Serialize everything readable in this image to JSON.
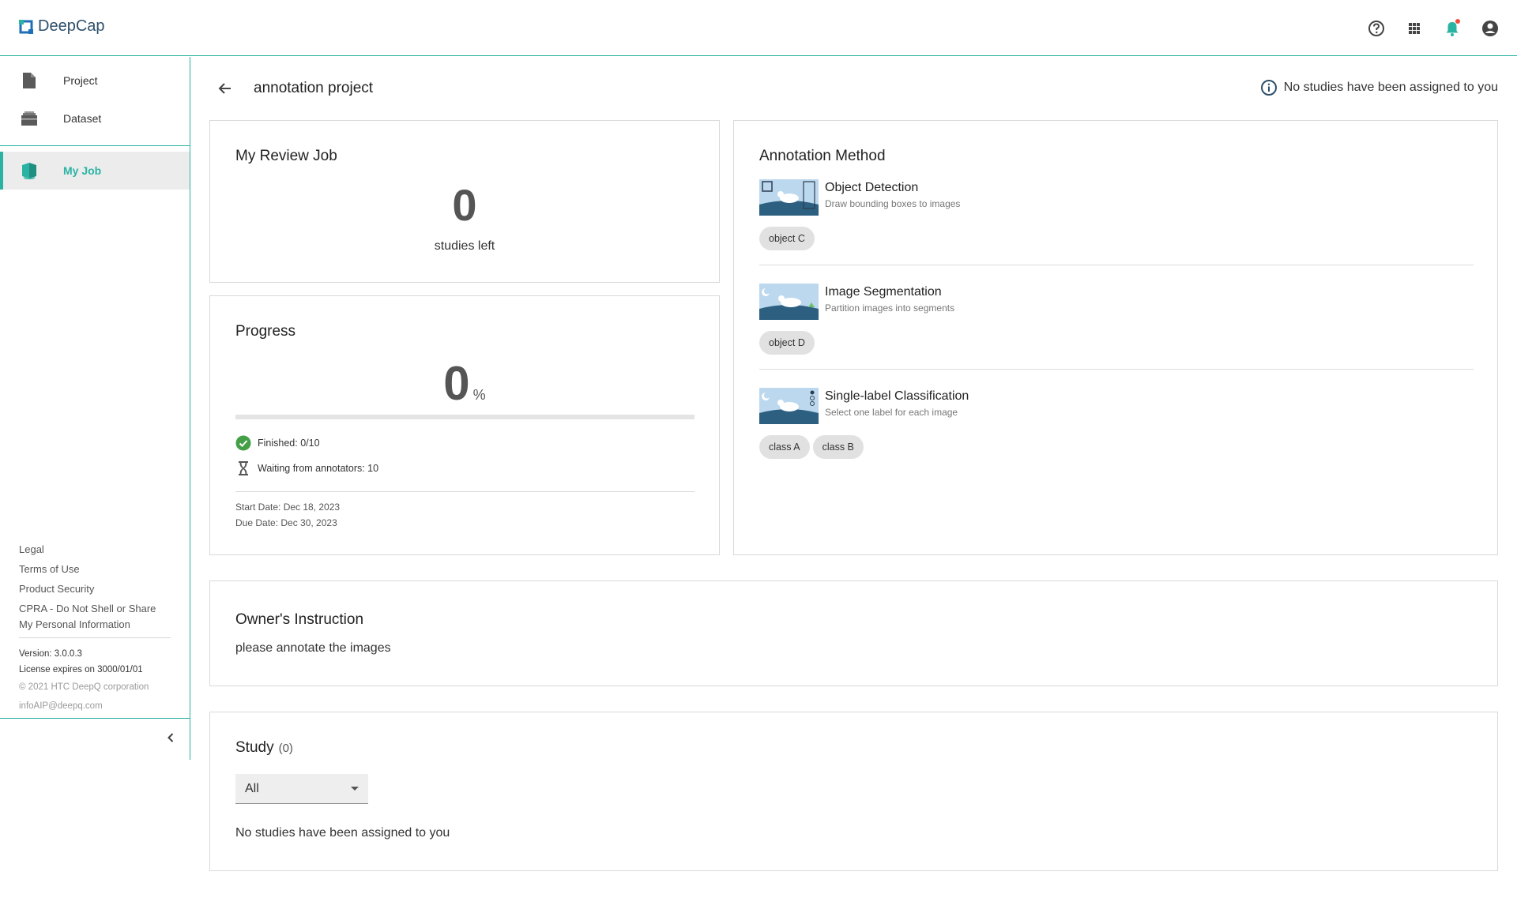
{
  "app": {
    "name": "DeepCap",
    "brand_color": "#2ab3a3"
  },
  "topbar": {
    "icons": [
      "help-circle-icon",
      "apps-grid-icon",
      "bell-icon",
      "account-circle-icon"
    ],
    "notification_dot_color": "#f04e3e"
  },
  "sidebar": {
    "items": [
      {
        "label": "Project",
        "icon": "file-icon"
      },
      {
        "label": "Dataset",
        "icon": "briefcase-icon"
      },
      {
        "label": "My Job",
        "icon": "book-icon",
        "active": true
      }
    ],
    "footer": {
      "legal": "Legal",
      "terms": "Terms of Use",
      "security": "Product Security",
      "cpra": "CPRA - Do Not Shell or Share My Personal Information",
      "version": "Version: 3.0.0.3",
      "license": "License expires on 3000/01/01",
      "copyright": "© 2021 HTC DeepQ corporation",
      "email": "infoAIP@deepq.com"
    }
  },
  "main": {
    "title": "annotation project",
    "assign_note": "No studies have been assigned to you",
    "review_job": {
      "title": "My Review Job",
      "count": "0",
      "subtitle": "studies left"
    },
    "progress": {
      "title": "Progress",
      "value": "0",
      "unit": "%",
      "fraction": 0,
      "finished": "Finished: 0/10",
      "waiting": "Waiting from annotators: 10",
      "start_date": "Start Date: Dec 18, 2023",
      "due_date": "Due Date: Dec 30, 2023"
    },
    "annotation_method": {
      "title": "Annotation Method",
      "methods": [
        {
          "name": "Object Detection",
          "desc": "Draw bounding boxes to images",
          "chips": [
            "object C"
          ]
        },
        {
          "name": "Image Segmentation",
          "desc": "Partition images into segments",
          "chips": [
            "object D"
          ]
        },
        {
          "name": "Single-label Classification",
          "desc": "Select one label for each image",
          "chips": [
            "class A",
            "class B"
          ]
        }
      ]
    },
    "instruction": {
      "title": "Owner's Instruction",
      "text": "please annotate the images"
    },
    "study": {
      "title": "Study",
      "count": "(0)",
      "filter_value": "All",
      "empty_text": "No studies have been assigned to you"
    }
  }
}
